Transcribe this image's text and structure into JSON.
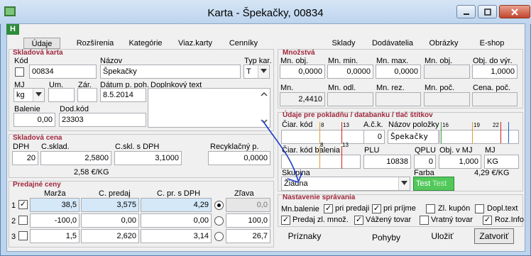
{
  "window": {
    "title": "Karta - Špekačky, 00834",
    "badge": "H"
  },
  "tabs": [
    "Údaje",
    "Rozšírenia",
    "Kategórie",
    "Viaz.karty",
    "Cenníky",
    "Sklady",
    "Dodávatelia",
    "Obrázky",
    "E-shop"
  ],
  "skladova_karta": {
    "title": "Skladová karta",
    "kod_label": "Kód",
    "kod": "00834",
    "nazov_label": "Názov",
    "nazov": "Špekačky",
    "typ_label": "Typ kar.",
    "typ": "T",
    "mj_label": "MJ",
    "mj": "kg",
    "um_label": "Um.",
    "zar_label": "Zár.",
    "datum_label": "Dátum p. poh.",
    "datum": "8.5.2014",
    "doplnkovy_label": "Doplnkový text",
    "balenie_label": "Balenie",
    "balenie": "0,00",
    "dodkod_label": "Dod.kód",
    "dodkod": "23303"
  },
  "skladova_cena": {
    "title": "Skladová cena",
    "dph_label": "DPH",
    "dph": "20",
    "csklad_label": "C.sklad.",
    "csklad": "2,5800",
    "cskl_dph_label": "C.skl. s DPH",
    "cskl_dph": "3,1000",
    "recyklacny_label": "Recyklačný p.",
    "recyklacny": "0,0000",
    "per_unit": "2,58 €/KG"
  },
  "predajne_ceny": {
    "title": "Predajné ceny",
    "headers": [
      "Marža",
      "C. predaj",
      "C. pr. s DPH",
      "Zľava"
    ],
    "rows": [
      {
        "n": "1",
        "checked": true,
        "marza": "38,5",
        "cpredaj": "3,575",
        "cdph": "4,29",
        "selected": true,
        "zlava": "0,0"
      },
      {
        "n": "2",
        "checked": false,
        "marza": "-100,0",
        "cpredaj": "0,00",
        "cdph": "0,00",
        "selected": false,
        "zlava": "100,0"
      },
      {
        "n": "3",
        "checked": false,
        "marza": "1,5",
        "cpredaj": "2,620",
        "cdph": "3,14",
        "selected": false,
        "zlava": "26,7"
      }
    ]
  },
  "mnozstva": {
    "title": "Množstvá",
    "row1_labels": [
      "Mn. obj.",
      "Mn. min.",
      "Mn. max.",
      "Mn. obj.",
      "Obj. do výr."
    ],
    "row1_values": [
      "0,0000",
      "0,0000",
      "0,0000",
      "",
      "1,0000"
    ],
    "row2_labels": [
      "Mn.",
      "Mn. odl.",
      "Mn. rez.",
      "Mn. poč.",
      "Cena. poč."
    ],
    "row2_values": [
      "2,4410",
      "",
      "",
      "",
      ""
    ]
  },
  "pokladna": {
    "title": "Údaje pre pokladňu / databanku / tlač štítkov",
    "ciar_kod_label": "Čiar. kód",
    "ack_label": "A.č.k.",
    "ack": "0",
    "nazov_polozky_label": "Názov položky",
    "nazov_polozky": "Špekačky",
    "ciar_kod_balenia_label": "Čiar. kód balenia",
    "plu_label": "PLU",
    "plu": "10838",
    "qplu_label": "QPLU",
    "qplu": "0",
    "obj_mj_label": "Obj. v MJ",
    "obj_mj": "1,000",
    "mj_label": "MJ",
    "mj": "KG",
    "skupina_label": "Skupina",
    "skupina": "Žiadna",
    "farba_label": "Farba",
    "farba_text1": "Test",
    "farba_text2": "Test",
    "per_unit": "4,29 €/KG",
    "scale_marks": [
      "8",
      "13",
      "16",
      "19",
      "22",
      "8",
      "13"
    ]
  },
  "nastavenie": {
    "title": "Nastavenie správania",
    "mn_balenie_label": "Mn.balenie",
    "items": [
      {
        "label": "pri predaji",
        "checked": true
      },
      {
        "label": "pri príjme",
        "checked": true
      },
      {
        "label": "Zl. kupón",
        "checked": false
      },
      {
        "label": "Dopl.text",
        "checked": false
      },
      {
        "label": "Predaj zl. množ.",
        "checked": true
      },
      {
        "label": "Vážený tovar",
        "checked": true
      },
      {
        "label": "Vratný tovar",
        "checked": false
      },
      {
        "label": "Roz.Info",
        "checked": true
      }
    ]
  },
  "buttons": {
    "priznaky": "Príznaky",
    "pohyby": "Pohyby",
    "ulozit": "Uložiť",
    "zatvorit": "Zatvoriť"
  },
  "colors": {
    "accent_title": "#a0283c",
    "farba_swatch": "#52c95a",
    "ack_red": "#d02020",
    "ack_orange": "#e0a030",
    "ack_green": "#40a040",
    "ack_blue": "#2060c0"
  }
}
